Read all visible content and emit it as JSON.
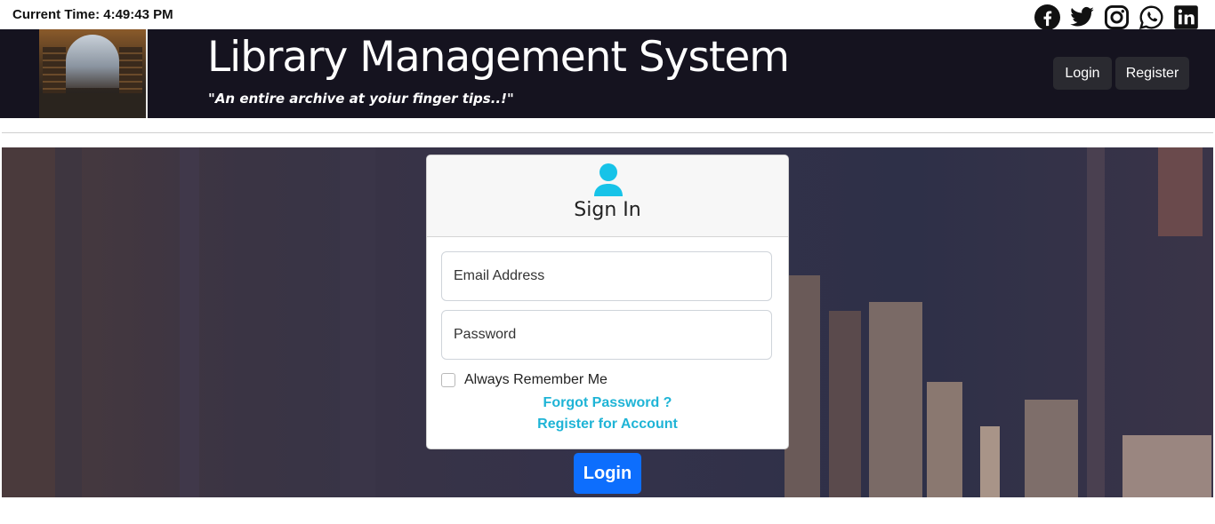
{
  "topbar": {
    "current_time": "Current Time: 4:49:43 PM",
    "social_icons": [
      "facebook-icon",
      "twitter-icon",
      "instagram-icon",
      "whatsapp-icon",
      "linkedin-icon"
    ]
  },
  "header": {
    "title": "Library Management System",
    "tagline": "\"An entire archive at yoiur finger tips..!\"",
    "nav": {
      "login_label": "Login",
      "register_label": "Register"
    }
  },
  "signin": {
    "title": "Sign In",
    "email_placeholder": "Email Address",
    "password_placeholder": "Password",
    "remember_label": "Always Remember Me",
    "forgot_link": "Forgot Password ?",
    "register_link": "Register for Account",
    "login_button": "Login"
  },
  "colors": {
    "header_bg": "#15131f",
    "accent_link": "#1fb4d6",
    "primary_button": "#0d6efd",
    "user_icon": "#17c3e8"
  }
}
